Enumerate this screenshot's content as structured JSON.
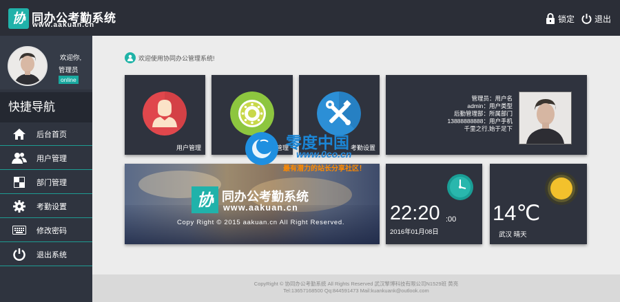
{
  "header": {
    "logo_char": "协",
    "title": "同办公考勤系统",
    "url": "www.aakuan.cn",
    "lock_label": "锁定",
    "logout_label": "退出"
  },
  "sidebar": {
    "welcome": "欢迎你,",
    "role": "管理员",
    "status": "online",
    "quick_nav": "快捷导航",
    "items": [
      {
        "label": "后台首页",
        "icon": "home-icon"
      },
      {
        "label": "用户管理",
        "icon": "users-icon"
      },
      {
        "label": "部门管理",
        "icon": "department-icon"
      },
      {
        "label": "考勤设置",
        "icon": "gear-icon"
      },
      {
        "label": "修改密码",
        "icon": "keyboard-icon"
      },
      {
        "label": "退出系统",
        "icon": "power-icon"
      }
    ]
  },
  "main": {
    "welcome_text": "欢迎使用协同办公管理系统!",
    "tiles": [
      {
        "label": "用户管理",
        "icon": "user-icon",
        "color": "#e0474c"
      },
      {
        "label": "部门管理",
        "icon": "wheel-icon",
        "color": "#8dc63f"
      },
      {
        "label": "考勤设置",
        "icon": "tools-icon",
        "color": "#2c8fd6"
      }
    ],
    "user_info": [
      "管理员：用户名",
      "admin：用户类型",
      "后勤管理部：所属部门",
      "13888888888：用户手机",
      "千里之行,始于足下"
    ],
    "banner": {
      "logo_char": "协",
      "title": "同办公考勤系统",
      "url": "www.aakuan.cn",
      "copyright": "Copy Right © 2015 aakuan.cn All Right Reserved."
    },
    "clock": {
      "time": "22:20",
      "seconds": ":00",
      "date": "2016年01月08日"
    },
    "weather": {
      "temperature": "14℃",
      "city_condition": "武汉 晴天"
    }
  },
  "watermark": {
    "title": "零度中国",
    "url": "www.0co.cn",
    "subtitle": "最有潜力的站长分享社区！"
  },
  "footer": {
    "line1": "CopyRight © 协同办公考勤系统 All Rights Reserved 武汉擎博科技有限公司N1529班 黄亮",
    "line2": "Tel:13657168500   Qq:844591473   Mail:kuankuank@outlook.com"
  },
  "colors": {
    "header": "#2b2e37",
    "sidebar": "#2f343f",
    "accent": "#1fb3a7",
    "tile": "#2f333e"
  }
}
